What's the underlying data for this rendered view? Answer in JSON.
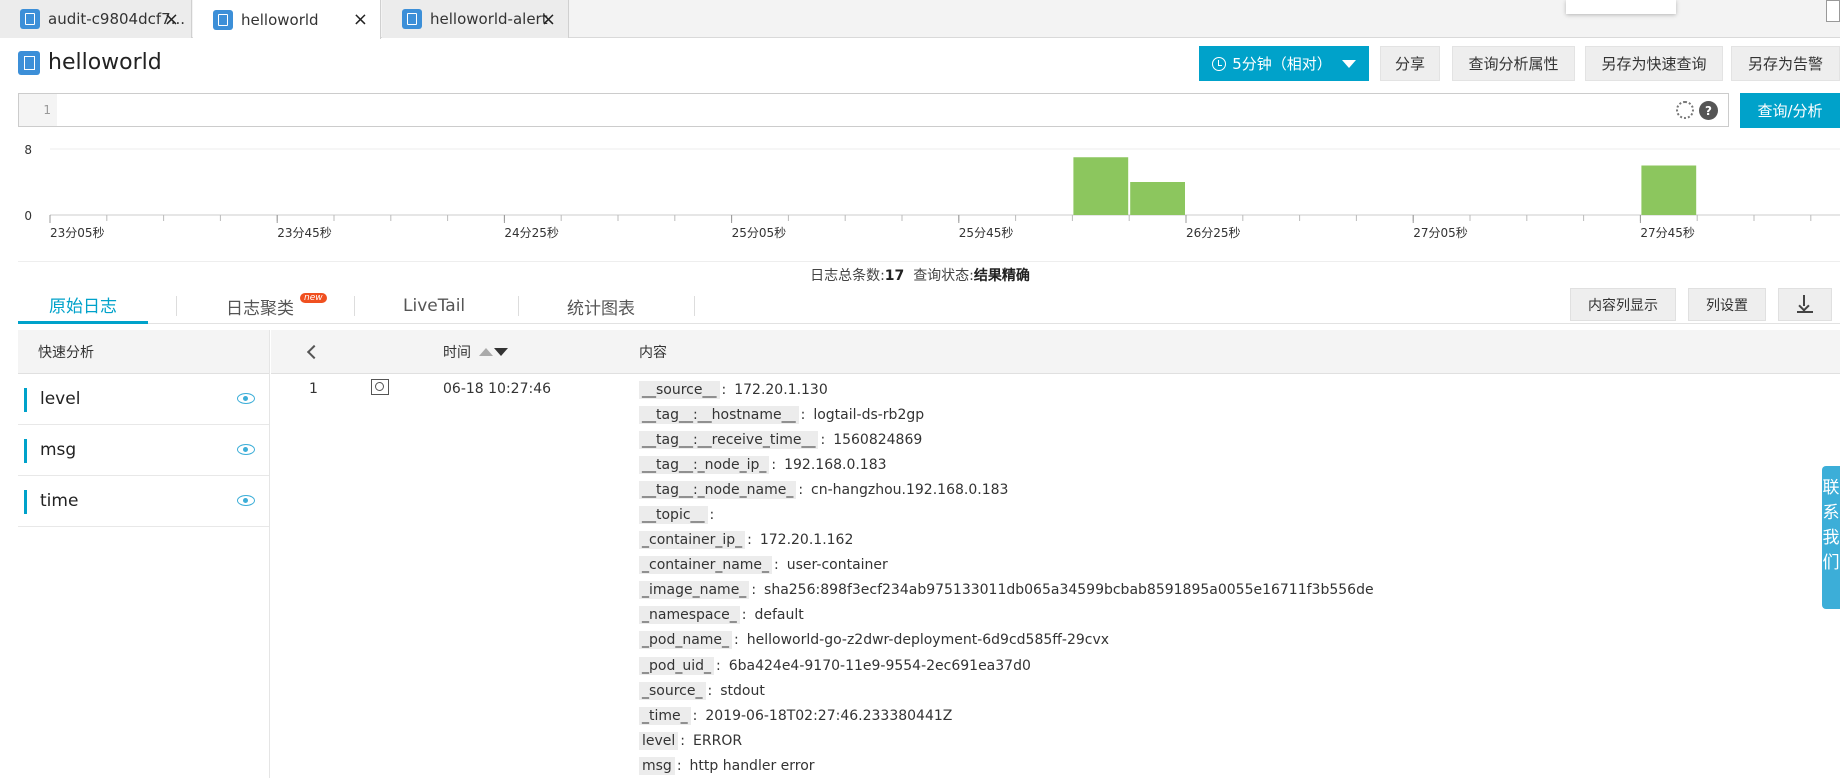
{
  "tabs": [
    {
      "label": "audit-c9804dcf7...",
      "close": "×"
    },
    {
      "label": "helloworld",
      "close": "×"
    },
    {
      "label": "helloworld-alert",
      "close": "×"
    }
  ],
  "header": {
    "title": "helloworld",
    "time_range": "5分钟（相对）",
    "share": "分享",
    "query_props": "查询分析属性",
    "save_quick": "另存为快速查询",
    "save_alert": "另存为告警"
  },
  "query": {
    "line_number": "1",
    "help": "?",
    "submit": "查询/分析"
  },
  "chart_data": {
    "type": "bar",
    "ylim": [
      0,
      8
    ],
    "yticks": [
      "8",
      "0"
    ],
    "xticks": [
      "23分05秒",
      "23分45秒",
      "24分25秒",
      "25分05秒",
      "25分45秒",
      "26分25秒",
      "27分05秒",
      "27分45秒"
    ],
    "bars": [
      {
        "x": "26分05秒",
        "value": 7
      },
      {
        "x": "26分15秒",
        "value": 4
      },
      {
        "x": "27分45秒",
        "value": 6
      }
    ],
    "color": "#8cc65e"
  },
  "summary": {
    "total_label": "日志总条数:",
    "total": "17",
    "status_label": "查询状态:",
    "status": "结果精确"
  },
  "result_tabs": {
    "raw": "原始日志",
    "cluster": "日志聚类",
    "new_badge": "new",
    "livetail": "LiveTail",
    "chart": "统计图表"
  },
  "result_actions": {
    "content_cols": "内容列显示",
    "col_settings": "列设置"
  },
  "quick_analysis": {
    "title": "快速分析",
    "fields": [
      "level",
      "msg",
      "time"
    ]
  },
  "table": {
    "time_header": "时间",
    "content_header": "内容",
    "row": {
      "index": "1",
      "time": "06-18 10:27:46",
      "fields": [
        {
          "key": "__source__",
          "value": "172.20.1.130"
        },
        {
          "key": "__tag__:__hostname__",
          "value": "logtail-ds-rb2gp"
        },
        {
          "key": "__tag__:__receive_time__",
          "value": "1560824869"
        },
        {
          "key": "__tag__:_node_ip_",
          "value": "192.168.0.183"
        },
        {
          "key": "__tag__:_node_name_",
          "value": "cn-hangzhou.192.168.0.183"
        },
        {
          "key": "__topic__",
          "value": ""
        },
        {
          "key": "_container_ip_",
          "value": "172.20.1.162"
        },
        {
          "key": "_container_name_",
          "value": "user-container"
        },
        {
          "key": "_image_name_",
          "value": "sha256:898f3ecf234ab975133011db065a34599bcbab8591895a0055e16711f3b556de"
        },
        {
          "key": "_namespace_",
          "value": "default"
        },
        {
          "key": "_pod_name_",
          "value": "helloworld-go-z2dwr-deployment-6d9cd585ff-29cvx"
        },
        {
          "key": "_pod_uid_",
          "value": "6ba424e4-9170-11e9-9554-2ec691ea37d0"
        },
        {
          "key": "_source_",
          "value": "stdout"
        },
        {
          "key": "_time_",
          "value": "2019-06-18T02:27:46.233380441Z"
        },
        {
          "key": "level",
          "value": "ERROR"
        },
        {
          "key": "msg",
          "value": "http handler error"
        }
      ]
    }
  },
  "contact": "联系我们"
}
